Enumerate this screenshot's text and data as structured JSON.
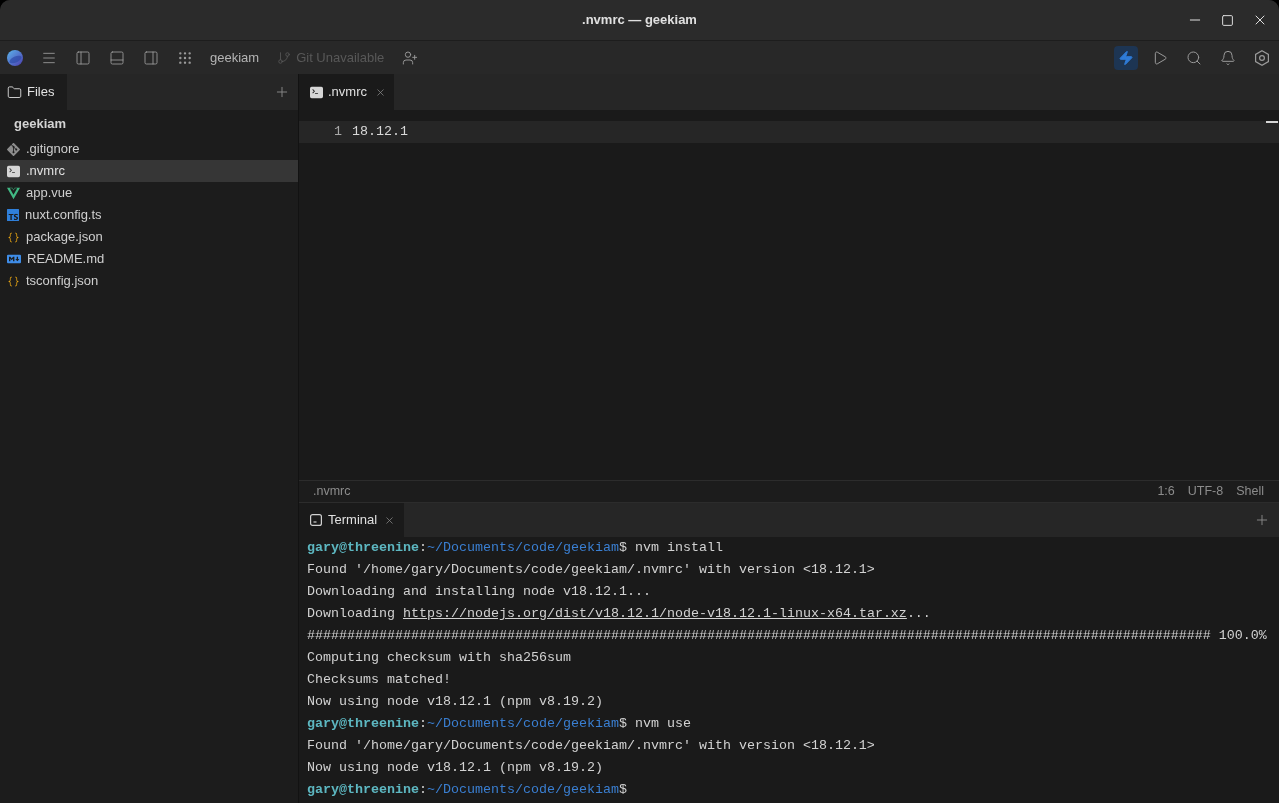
{
  "window": {
    "title": ".nvmrc — geekiam"
  },
  "toolbar": {
    "project": "geekiam",
    "git": {
      "label": "Git Unavailable",
      "disabled": true
    },
    "actions": [
      {
        "kind": "bolt",
        "active": true
      },
      {
        "kind": "run",
        "active": false
      },
      {
        "kind": "search",
        "active": false
      },
      {
        "kind": "notifications",
        "active": false
      },
      {
        "kind": "settings",
        "active": false
      }
    ]
  },
  "sidebar": {
    "tabs": [
      {
        "label": "Files",
        "selected": true
      }
    ],
    "project": "geekiam",
    "files": [
      {
        "name": ".gitignore",
        "kind": "git",
        "selected": false
      },
      {
        "name": ".nvmrc",
        "kind": "shell",
        "selected": true
      },
      {
        "name": "app.vue",
        "kind": "vue",
        "selected": false
      },
      {
        "name": "nuxt.config.ts",
        "kind": "typescript",
        "selected": false
      },
      {
        "name": "package.json",
        "kind": "json",
        "selected": false
      },
      {
        "name": "README.md",
        "kind": "markdown",
        "selected": false
      },
      {
        "name": "tsconfig.json",
        "kind": "json",
        "selected": false
      }
    ]
  },
  "editor": {
    "tabs": [
      {
        "label": ".nvmrc",
        "kind": "shell",
        "selected": true
      }
    ],
    "lines": [
      {
        "number": "1",
        "text": "18.12.1",
        "current": true
      }
    ]
  },
  "status_bar": {
    "file": ".nvmrc",
    "position": "1:6",
    "encoding": "UTF-8",
    "language": "Shell"
  },
  "terminal": {
    "tabs": [
      {
        "label": "Terminal",
        "selected": true
      }
    ],
    "lines": [
      {
        "kind": "prompt",
        "user": "gary@threenine",
        "separator": ":",
        "path": "~/Documents/code/geekiam",
        "symbol": "$",
        "command": "nvm install"
      },
      {
        "kind": "output",
        "text": "Found '/home/gary/Documents/code/geekiam/.nvmrc' with version <18.12.1>"
      },
      {
        "kind": "output",
        "text": "Downloading and installing node v18.12.1..."
      },
      {
        "kind": "link",
        "before": "Downloading",
        "link": "https://nodejs.org/dist/v18.12.1/node-v18.12.1-linux-x64.tar.xz",
        "after": "..."
      },
      {
        "kind": "output",
        "text": "################################################################################################################# 100.0%"
      },
      {
        "kind": "output",
        "text": "Computing checksum with sha256sum"
      },
      {
        "kind": "output",
        "text": "Checksums matched!"
      },
      {
        "kind": "output",
        "text": "Now using node v18.12.1 (npm v8.19.2)"
      },
      {
        "kind": "prompt",
        "user": "gary@threenine",
        "separator": ":",
        "path": "~/Documents/code/geekiam",
        "symbol": "$",
        "command": "nvm use"
      },
      {
        "kind": "output",
        "text": "Found '/home/gary/Documents/code/geekiam/.nvmrc' with version <18.12.1>"
      },
      {
        "kind": "output",
        "text": "Now using node v18.12.1 (npm v8.19.2)"
      },
      {
        "kind": "prompt",
        "user": "gary@threenine",
        "separator": ":",
        "path": "~/Documents/code/geekiam",
        "symbol": "$"
      }
    ]
  }
}
